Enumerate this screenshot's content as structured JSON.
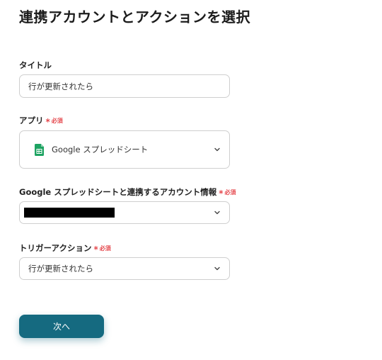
{
  "page": {
    "title": "連携アカウントとアクションを選択"
  },
  "title_field": {
    "label": "タイトル",
    "value": "行が更新されたら"
  },
  "app_field": {
    "label": "アプリ",
    "required_mark": "*",
    "required_text": "必須",
    "selected_app": "Google スプレッドシート",
    "app_icon": "google-sheets-icon",
    "app_icon_color": "#1ea362"
  },
  "account_field": {
    "label": "Google スプレッドシートと連携するアカウント情報",
    "required_mark": "*",
    "value_redacted": true
  },
  "trigger_field": {
    "label": "トリガーアクション",
    "required_mark": "*",
    "required_text": "必須",
    "value": "行が更新されたら"
  },
  "actions": {
    "next_label": "次へ",
    "next_color": "#156a80"
  },
  "colors": {
    "required": "#e5484d",
    "border": "#cfcfcf"
  }
}
